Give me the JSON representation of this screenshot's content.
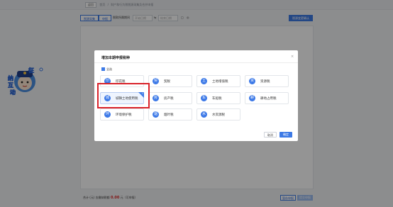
{
  "breadcrumb": {
    "back_label": "返回",
    "home_label": "首页",
    "page_label": "财产和行为税税源采集及合并申报"
  },
  "toolbar": {
    "tax_source_label": "税源采集",
    "report_label": "申报",
    "period_label": "税款所属期间",
    "period_start": "开始日期",
    "period_end": "结束日期",
    "confirm_label": "税源变更确认"
  },
  "mascot": {
    "text_top": "征",
    "text_left": "纳",
    "text_mid": "互",
    "text_bottom": "动"
  },
  "modal": {
    "title": "增加本期申报税种",
    "close_glyph": "×",
    "select_all_label": "全选",
    "tax_types": [
      {
        "label": "印花税",
        "icon": "印",
        "selected": false
      },
      {
        "label": "契税",
        "icon": "契",
        "selected": false
      },
      {
        "label": "土地增值税",
        "icon": "土",
        "selected": false
      },
      {
        "label": "资源税",
        "icon": "资",
        "selected": false
      },
      {
        "label": "城镇土地使用税",
        "icon": "城",
        "selected": true
      },
      {
        "label": "房产税",
        "icon": "房",
        "selected": false
      },
      {
        "label": "车船税",
        "icon": "车",
        "selected": false
      },
      {
        "label": "耕地占用税",
        "icon": "耕",
        "selected": false
      },
      {
        "label": "环境保护税",
        "icon": "环",
        "selected": false
      },
      {
        "label": "烟叶税",
        "icon": "烟",
        "selected": false
      },
      {
        "label": "水资源税",
        "icon": "水",
        "selected": false
      }
    ],
    "cancel_label": "取消",
    "ok_label": "确定"
  },
  "footer": {
    "text_before": "合计",
    "text_unit": "(元)",
    "text_label": "应缴纳税额",
    "amount": "0.00",
    "text_after": "元（可申报）",
    "save_label": "暂存申报",
    "submit_label": "提交申报"
  },
  "colors": {
    "accent": "#3d7ae6",
    "highlight": "#d9222a",
    "amount": "#e02d2d"
  }
}
